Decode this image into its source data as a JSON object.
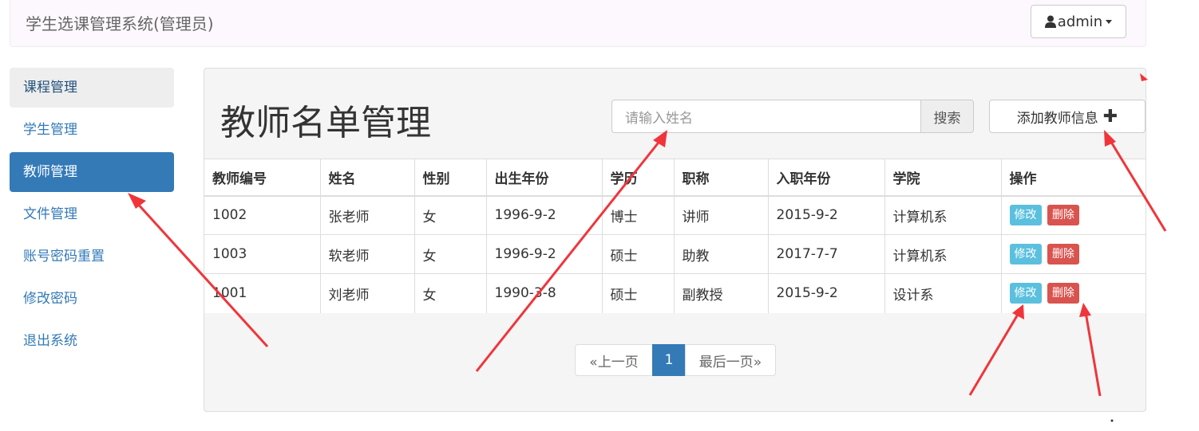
{
  "navbar": {
    "brand": "学生选课管理系统(管理员)",
    "user_label": "admin"
  },
  "sidebar": {
    "items": [
      {
        "label": "课程管理",
        "state": "hover"
      },
      {
        "label": "学生管理",
        "state": "normal"
      },
      {
        "label": "教师管理",
        "state": "active"
      },
      {
        "label": "文件管理",
        "state": "normal"
      },
      {
        "label": "账号密码重置",
        "state": "normal"
      },
      {
        "label": "修改密码",
        "state": "normal"
      },
      {
        "label": "退出系统",
        "state": "normal"
      }
    ]
  },
  "main": {
    "title": "教师名单管理",
    "search": {
      "placeholder": "请输入姓名",
      "button": "搜索"
    },
    "add_button": "添加教师信息"
  },
  "table": {
    "headers": [
      "教师编号",
      "姓名",
      "性别",
      "出生年份",
      "学历",
      "职称",
      "入职年份",
      "学院",
      "操作"
    ],
    "rows": [
      [
        "1002",
        "张老师",
        "女",
        "1996-9-2",
        "博士",
        "讲师",
        "2015-9-2",
        "计算机系"
      ],
      [
        "1003",
        "软老师",
        "女",
        "1996-9-2",
        "硕士",
        "助教",
        "2017-7-7",
        "计算机系"
      ],
      [
        "1001",
        "刘老师",
        "女",
        "1990-3-8",
        "硕士",
        "副教授",
        "2015-9-2",
        "设计系"
      ]
    ],
    "edit_label": "修改",
    "delete_label": "删除"
  },
  "pagination": {
    "prev": "«上一页",
    "current": "1",
    "last": "最后一页»"
  },
  "colors": {
    "primary": "#337ab7",
    "info": "#5bc0de",
    "danger": "#d9534f",
    "annotation_arrow": "#f0353a"
  }
}
